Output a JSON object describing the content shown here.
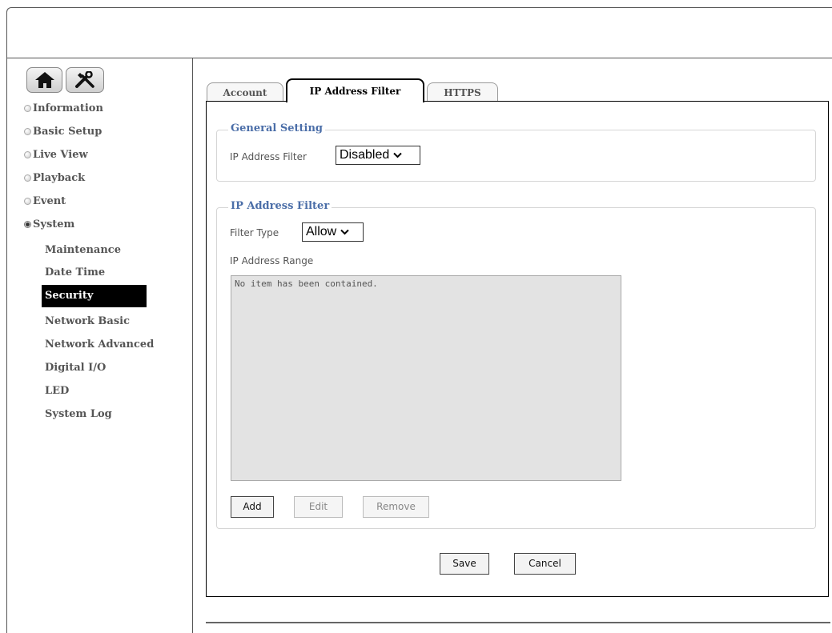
{
  "sidebar": {
    "menu": [
      {
        "label": "Information",
        "selected": false
      },
      {
        "label": "Basic Setup",
        "selected": false
      },
      {
        "label": "Live View",
        "selected": false
      },
      {
        "label": "Playback",
        "selected": false
      },
      {
        "label": "Event",
        "selected": false
      },
      {
        "label": "System",
        "selected": true
      }
    ],
    "submenu": [
      "Maintenance",
      "Date Time",
      "Security",
      "Network Basic",
      "Network Advanced",
      "Digital I/O",
      "LED",
      "System Log"
    ],
    "active_submenu": "Security",
    "top_buttons": [
      {
        "icon": "home-icon"
      },
      {
        "icon": "tools-icon"
      }
    ]
  },
  "tabs": [
    {
      "label": "Account",
      "active": false
    },
    {
      "label": "IP Address Filter",
      "active": true
    },
    {
      "label": "HTTPS",
      "active": false
    }
  ],
  "general_setting": {
    "legend": "General Setting",
    "ip_filter_label": "IP Address Filter",
    "ip_filter_value": "Disabled"
  },
  "ip_address_filter": {
    "legend": "IP Address Filter",
    "filter_type_label": "Filter Type",
    "filter_type_value": "Allow",
    "range_label": "IP Address Range",
    "range_empty_text": "No item has been contained.",
    "add_label": "Add",
    "edit_label": "Edit",
    "remove_label": "Remove"
  },
  "footer": {
    "save_label": "Save",
    "cancel_label": "Cancel"
  },
  "colors": {
    "legend": "#4b6ea8",
    "active_menu_bg": "#000000"
  }
}
